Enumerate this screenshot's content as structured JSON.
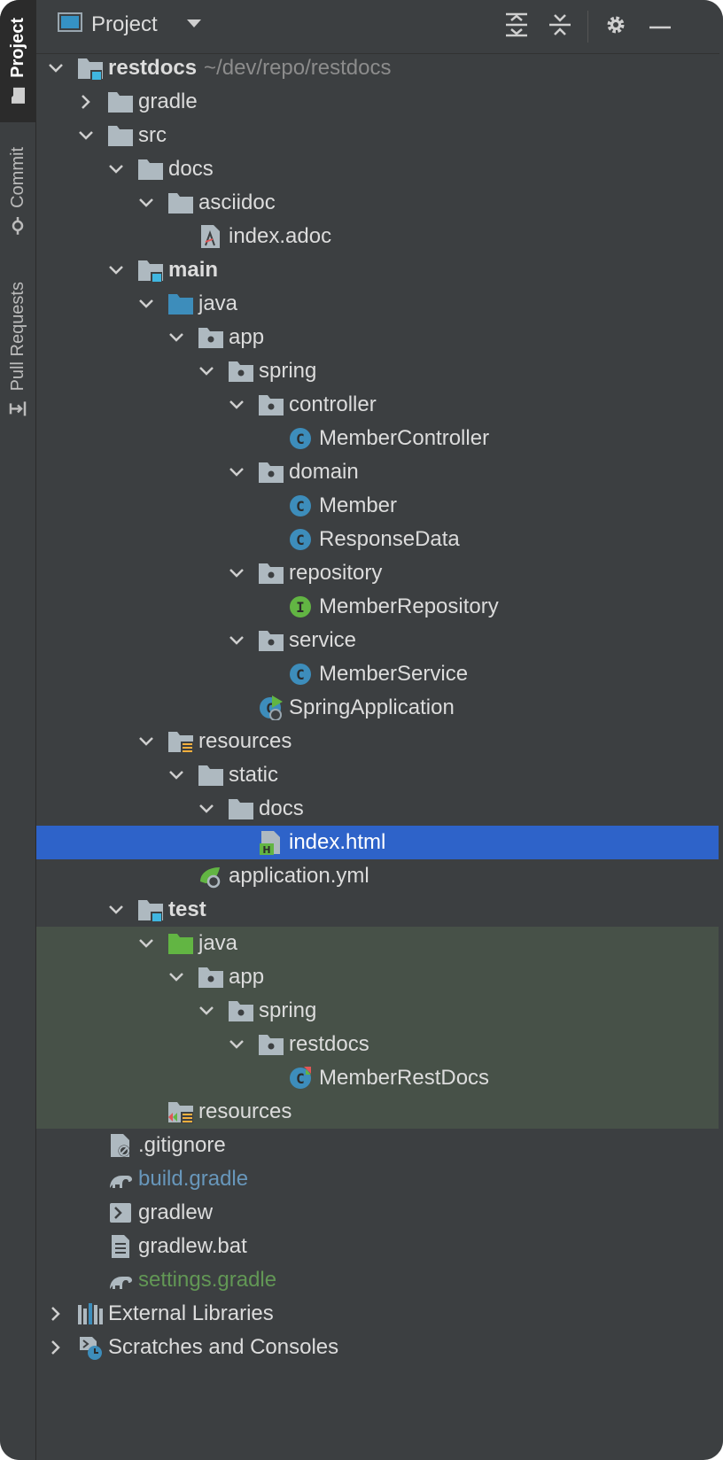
{
  "side_tabs": [
    {
      "label": "Project",
      "icon": "folder-icon",
      "active": true
    },
    {
      "label": "Commit",
      "icon": "commit-icon",
      "active": false
    },
    {
      "label": "Pull Requests",
      "icon": "pull-request-icon",
      "active": false
    }
  ],
  "header": {
    "title": "Project",
    "expand_all_icon": "expand-all-icon",
    "collapse_all_icon": "collapse-all-icon",
    "settings_icon": "gear-icon",
    "hide_icon": "minimize-icon"
  },
  "tree": [
    {
      "label": "restdocs",
      "path_hint": "~/dev/repo/restdocs",
      "depth": 0,
      "chevron": "down",
      "icon": "module-folder-icon",
      "style": "bold"
    },
    {
      "label": "gradle",
      "depth": 1,
      "chevron": "right",
      "icon": "folder-icon"
    },
    {
      "label": "src",
      "depth": 1,
      "chevron": "down",
      "icon": "folder-icon"
    },
    {
      "label": "docs",
      "depth": 2,
      "chevron": "down",
      "icon": "folder-icon"
    },
    {
      "label": "asciidoc",
      "depth": 3,
      "chevron": "down",
      "icon": "folder-icon"
    },
    {
      "label": "index.adoc",
      "depth": 4,
      "chevron": "none",
      "icon": "asciidoc-file-icon"
    },
    {
      "label": "main",
      "depth": 2,
      "chevron": "down",
      "icon": "module-folder-icon",
      "style": "bold"
    },
    {
      "label": "java",
      "depth": 3,
      "chevron": "down",
      "icon": "source-folder-icon"
    },
    {
      "label": "app",
      "depth": 4,
      "chevron": "down",
      "icon": "package-icon"
    },
    {
      "label": "spring",
      "depth": 5,
      "chevron": "down",
      "icon": "package-icon"
    },
    {
      "label": "controller",
      "depth": 6,
      "chevron": "down",
      "icon": "package-icon"
    },
    {
      "label": "MemberController",
      "depth": 7,
      "chevron": "none",
      "icon": "class-icon"
    },
    {
      "label": "domain",
      "depth": 6,
      "chevron": "down",
      "icon": "package-icon"
    },
    {
      "label": "Member",
      "depth": 7,
      "chevron": "none",
      "icon": "class-icon"
    },
    {
      "label": "ResponseData",
      "depth": 7,
      "chevron": "none",
      "icon": "class-icon"
    },
    {
      "label": "repository",
      "depth": 6,
      "chevron": "down",
      "icon": "package-icon"
    },
    {
      "label": "MemberRepository",
      "depth": 7,
      "chevron": "none",
      "icon": "interface-icon"
    },
    {
      "label": "service",
      "depth": 6,
      "chevron": "down",
      "icon": "package-icon"
    },
    {
      "label": "MemberService",
      "depth": 7,
      "chevron": "none",
      "icon": "class-icon"
    },
    {
      "label": "SpringApplication",
      "depth": 6,
      "chevron": "none",
      "icon": "spring-boot-class-icon"
    },
    {
      "label": "resources",
      "depth": 3,
      "chevron": "down",
      "icon": "resources-folder-icon"
    },
    {
      "label": "static",
      "depth": 4,
      "chevron": "down",
      "icon": "folder-icon"
    },
    {
      "label": "docs",
      "depth": 5,
      "chevron": "down",
      "icon": "folder-icon"
    },
    {
      "label": "index.html",
      "depth": 6,
      "chevron": "none",
      "icon": "html-file-icon",
      "selected": true
    },
    {
      "label": "application.yml",
      "depth": 4,
      "chevron": "none",
      "icon": "spring-yml-icon"
    },
    {
      "label": "test",
      "depth": 2,
      "chevron": "down",
      "icon": "module-folder-icon",
      "style": "bold"
    },
    {
      "label": "java",
      "depth": 3,
      "chevron": "down",
      "icon": "test-folder-icon",
      "highlight": true
    },
    {
      "label": "app",
      "depth": 4,
      "chevron": "down",
      "icon": "package-icon",
      "highlight": true
    },
    {
      "label": "spring",
      "depth": 5,
      "chevron": "down",
      "icon": "package-icon",
      "highlight": true
    },
    {
      "label": "restdocs",
      "depth": 6,
      "chevron": "down",
      "icon": "package-icon",
      "highlight": true
    },
    {
      "label": "MemberRestDocs",
      "depth": 7,
      "chevron": "none",
      "icon": "test-class-icon",
      "highlight": true
    },
    {
      "label": "resources",
      "depth": 3,
      "chevron": "none",
      "icon": "test-resources-folder-icon",
      "highlight": true
    },
    {
      "label": ".gitignore",
      "depth": 1,
      "chevron": "none",
      "icon": "gitignore-file-icon"
    },
    {
      "label": "build.gradle",
      "depth": 1,
      "chevron": "none",
      "icon": "gradle-icon",
      "style": "blue"
    },
    {
      "label": "gradlew",
      "depth": 1,
      "chevron": "none",
      "icon": "shell-script-icon"
    },
    {
      "label": "gradlew.bat",
      "depth": 1,
      "chevron": "none",
      "icon": "text-file-icon"
    },
    {
      "label": "settings.gradle",
      "depth": 1,
      "chevron": "none",
      "icon": "gradle-icon",
      "style": "green"
    },
    {
      "label": "External Libraries",
      "depth": 0,
      "chevron": "right",
      "icon": "libraries-icon"
    },
    {
      "label": "Scratches and Consoles",
      "depth": 0,
      "chevron": "right",
      "icon": "scratches-icon"
    }
  ]
}
